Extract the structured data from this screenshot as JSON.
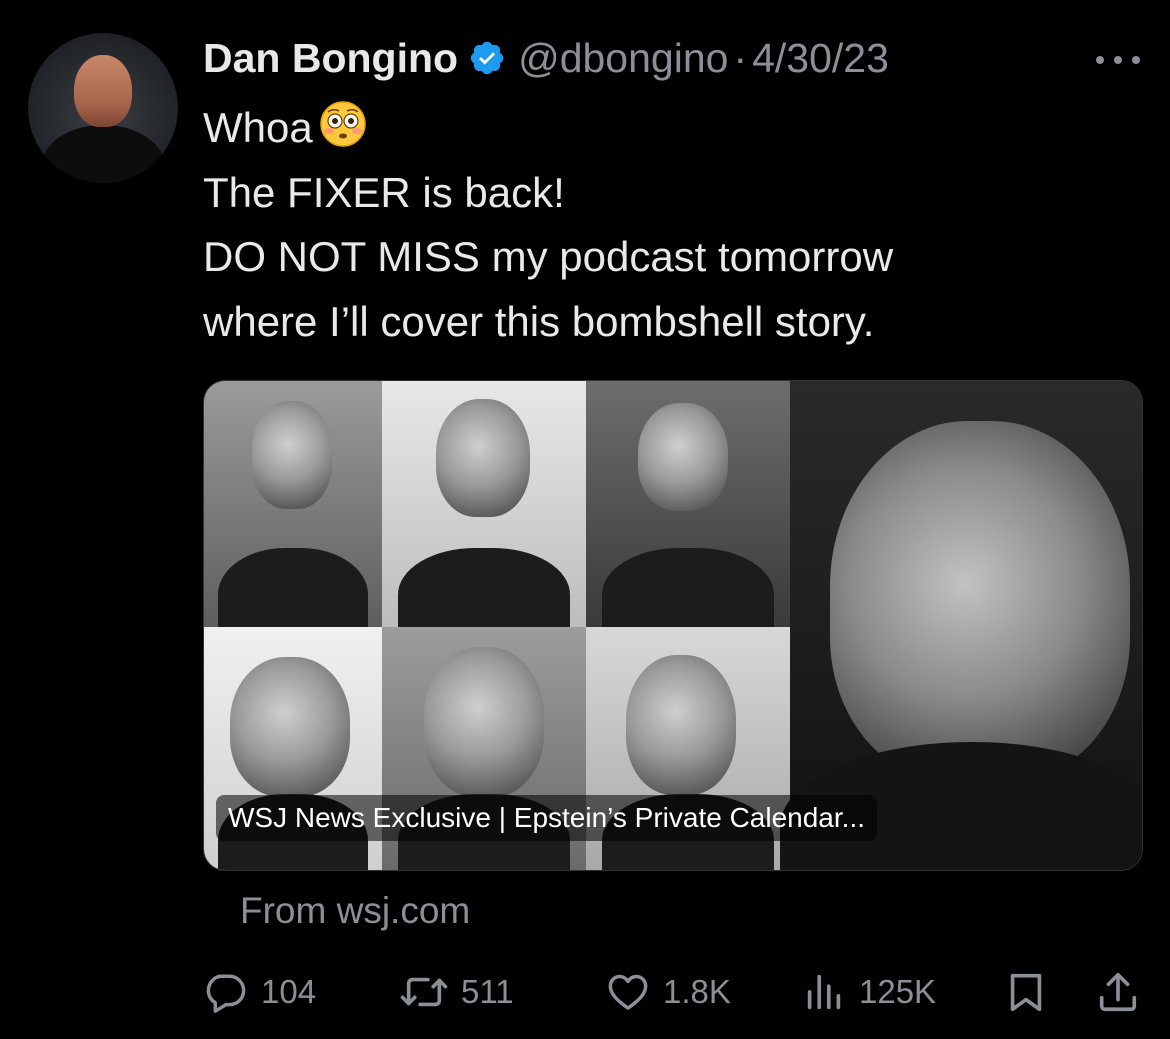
{
  "author": {
    "name": "Dan Bongino",
    "handle": "@dbongino",
    "separator": "·",
    "date": "4/30/23",
    "verified": true,
    "verified_color": "#1d9bf0"
  },
  "tweet": {
    "lines": [
      "Whoa",
      "The FIXER is back!",
      "DO NOT MISS my podcast tomorrow",
      "where I’ll cover this bombshell story."
    ],
    "emoji": "flushed-face-emoji"
  },
  "card": {
    "caption": "WSJ News Exclusive | Epstein’s Private Calendar...",
    "source": "From wsj.com"
  },
  "actions": {
    "replies": "104",
    "retweets": "511",
    "likes": "1.8K",
    "views": "125K"
  },
  "colors": {
    "background": "#000000",
    "text": "#e7e9ea",
    "secondary": "#8b9096"
  }
}
